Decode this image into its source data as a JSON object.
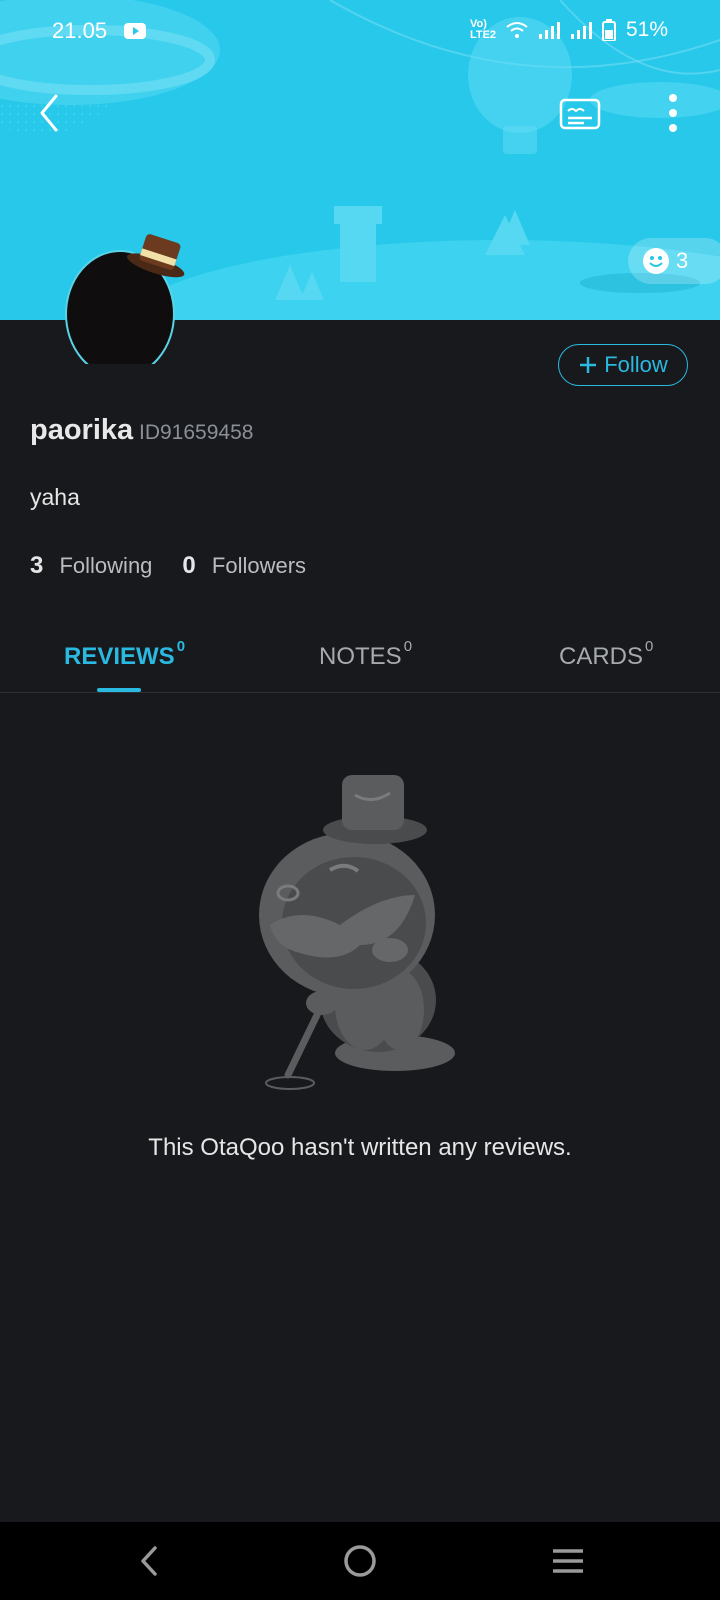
{
  "status_bar": {
    "time": "21.05",
    "network_label": "Vo) LTE2",
    "battery": "51%"
  },
  "header": {
    "reaction_count": "3"
  },
  "profile": {
    "username": "paorika",
    "user_id": "ID91659458",
    "bio": "yaha",
    "follow_label": "Follow",
    "following_count": "3",
    "following_label": "Following",
    "followers_count": "0",
    "followers_label": "Followers"
  },
  "tabs": [
    {
      "label": "REVIEWS",
      "count": "0",
      "active": true
    },
    {
      "label": "NOTES",
      "count": "0",
      "active": false
    },
    {
      "label": "CARDS",
      "count": "0",
      "active": false
    }
  ],
  "empty_state": {
    "message": "This OtaQoo hasn't written any reviews."
  },
  "icons": {
    "back": "back-arrow-icon",
    "card": "id-card-icon",
    "more": "more-vertical-icon",
    "reaction": "smiley-icon"
  },
  "colors": {
    "accent": "#2ab9e0",
    "header_bg": "#27c8ea",
    "page_bg": "#17191c"
  }
}
